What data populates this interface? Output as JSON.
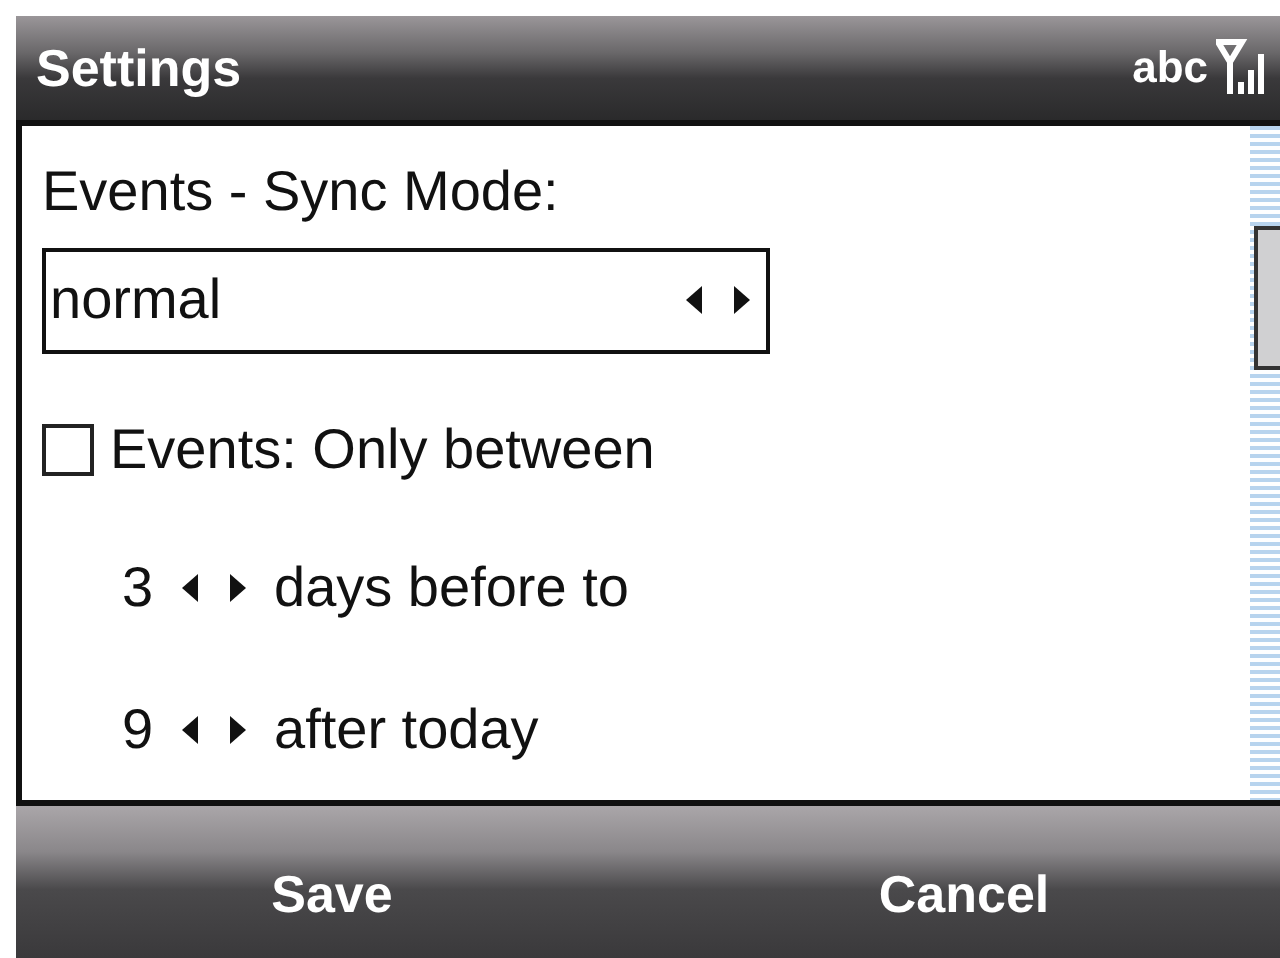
{
  "window": {
    "title": "Settings",
    "input_mode": "abc"
  },
  "fields": [
    {
      "kind": "label",
      "text": "Events - Sync Mode:"
    },
    {
      "kind": "picker",
      "value": "normal"
    },
    {
      "kind": "checkbox",
      "label": "Events: Only between",
      "checked": false
    },
    {
      "kind": "spinner",
      "value": "3",
      "label": "days before to"
    },
    {
      "kind": "spinner",
      "value": "9",
      "label": "after today"
    }
  ],
  "softkeys": [
    "Save",
    "Cancel"
  ]
}
